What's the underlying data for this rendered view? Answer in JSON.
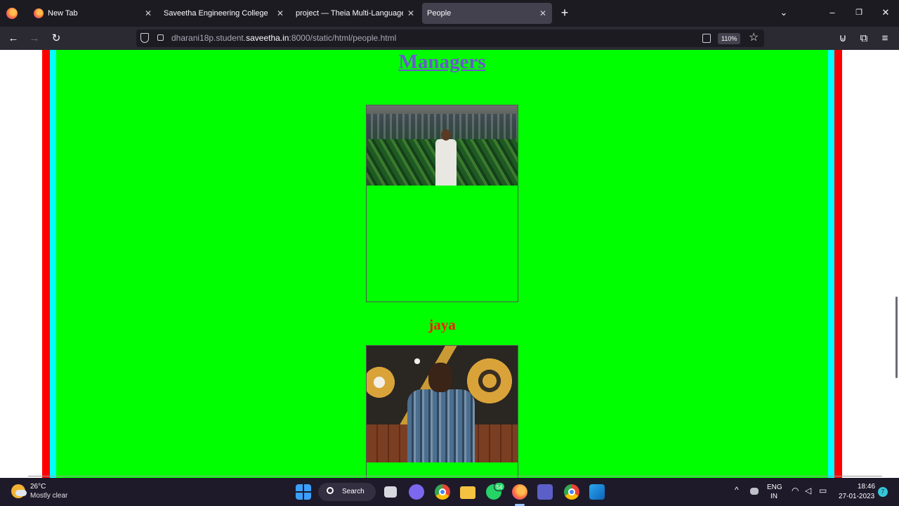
{
  "browser": {
    "tabs": [
      {
        "label": "New Tab",
        "active": false
      },
      {
        "label": "Saveetha Engineering College",
        "active": false
      },
      {
        "label": "project — Theia Multi-Language Ex",
        "active": false
      },
      {
        "label": "People",
        "active": true
      }
    ],
    "url_prefix": "dharani18p.student.",
    "url_domain": "saveetha.in",
    "url_suffix": ":8000/static/html/people.html",
    "zoom": "110%"
  },
  "page": {
    "heading": "Managers",
    "people": [
      {
        "name": "jaya"
      }
    ],
    "colors": {
      "outer_border": "#ff0000",
      "inner_border": "#00ffff",
      "background": "#00ff00",
      "heading": "#6a5acd",
      "name": "#ff1a00"
    }
  },
  "taskbar": {
    "temperature": "26°C",
    "condition": "Mostly clear",
    "search_label": "Search",
    "whatsapp_badge": "54",
    "lang_top": "ENG",
    "lang_bottom": "IN",
    "time": "18:46",
    "date": "27-01-2023",
    "notifications": "7"
  }
}
